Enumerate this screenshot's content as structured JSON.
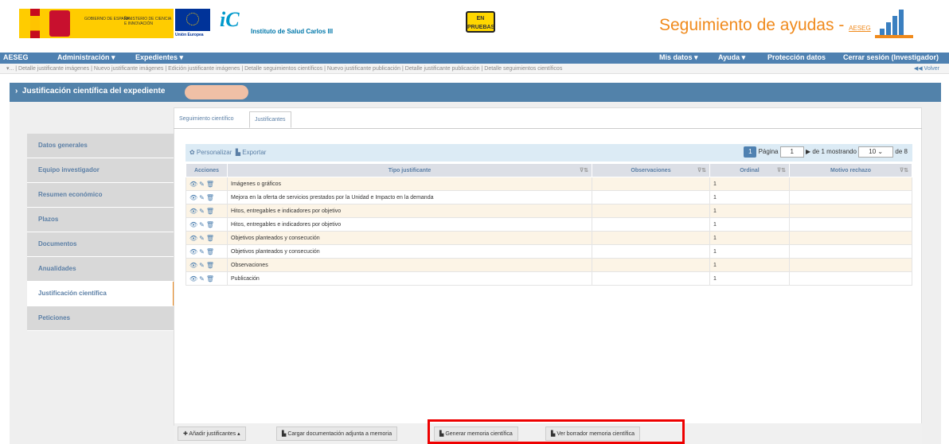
{
  "header": {
    "ministry_left": "GOBIERNO DE ESPAÑA",
    "ministry_right": "MINISTERIO DE CIENCIA E INNOVACIÓN",
    "eu_label": "Unión Europea",
    "isc_name": "Instituto de Salud Carlos III",
    "badge": "EN PRUEBAS",
    "brand": "Seguimiento de ayudas - ",
    "brand_small": "AESEG"
  },
  "nav": {
    "aeseg": "AESEG",
    "admin": "Administración ▾",
    "exp": "Expedientes ▾",
    "mis": "Mis datos ▾",
    "ayuda": "Ayuda ▾",
    "proteccion": "Protección datos",
    "cerrar": "Cerrar sesión (Investigador)"
  },
  "breadcrumb": {
    "items": "▾... | Detalle justificante imágenes | Nuevo justificante imágenes | Edición justificante imágenes | Detalle seguimientos científicos | Nuevo justificante publicación | Detalle justificante publicación | Detalle seguimientos científicos",
    "volver": "◀◀ Volver"
  },
  "band": {
    "title": "Justificación científica del expediente"
  },
  "sidebar": {
    "items": [
      {
        "label": "Datos generales"
      },
      {
        "label": "Equipo investigador"
      },
      {
        "label": "Resumen económico"
      },
      {
        "label": "Plazos"
      },
      {
        "label": "Documentos"
      },
      {
        "label": "Anualidades"
      },
      {
        "label": "Justificación científica"
      },
      {
        "label": "Peticiones"
      }
    ]
  },
  "tabs": {
    "t1": "Seguimiento científico",
    "t2": "Justificantes"
  },
  "toolbar": {
    "personalizar": "✿ Personalizar",
    "exportar": "Exportar"
  },
  "pager": {
    "current": "1",
    "page_label": "Página",
    "page_value": "1",
    "of_label": "de 1 mostrando",
    "per_page": "10",
    "total": "de 8"
  },
  "table": {
    "headers": {
      "acciones": "Acciones",
      "tipo": "Tipo justificante",
      "obs": "Observaciones",
      "ordinal": "Ordinal",
      "motivo": "Motivo rechazo"
    },
    "rows": [
      {
        "tipo": "Imágenes o gráficos",
        "ordinal": "1"
      },
      {
        "tipo": "Mejora en la oferta de servicios prestados por la Unidad e Impacto en la demanda",
        "ordinal": "1"
      },
      {
        "tipo": "Hitos, entregables e indicadores por objetivo",
        "ordinal": "1"
      },
      {
        "tipo": "Hitos, entregables e indicadores por objetivo",
        "ordinal": "1"
      },
      {
        "tipo": "Objetivos planteados y consecución",
        "ordinal": "1"
      },
      {
        "tipo": "Objetivos planteados y consecución",
        "ordinal": "1"
      },
      {
        "tipo": "Observaciones",
        "ordinal": "1"
      },
      {
        "tipo": "Publicación",
        "ordinal": "1"
      }
    ]
  },
  "footer": {
    "anadir": "✚ Añadir justificantes ▴",
    "cargar": "Cargar documentación adjunta a memoria",
    "generar": "Generar memoria científica",
    "ver": "Ver borrador memoria científica"
  }
}
